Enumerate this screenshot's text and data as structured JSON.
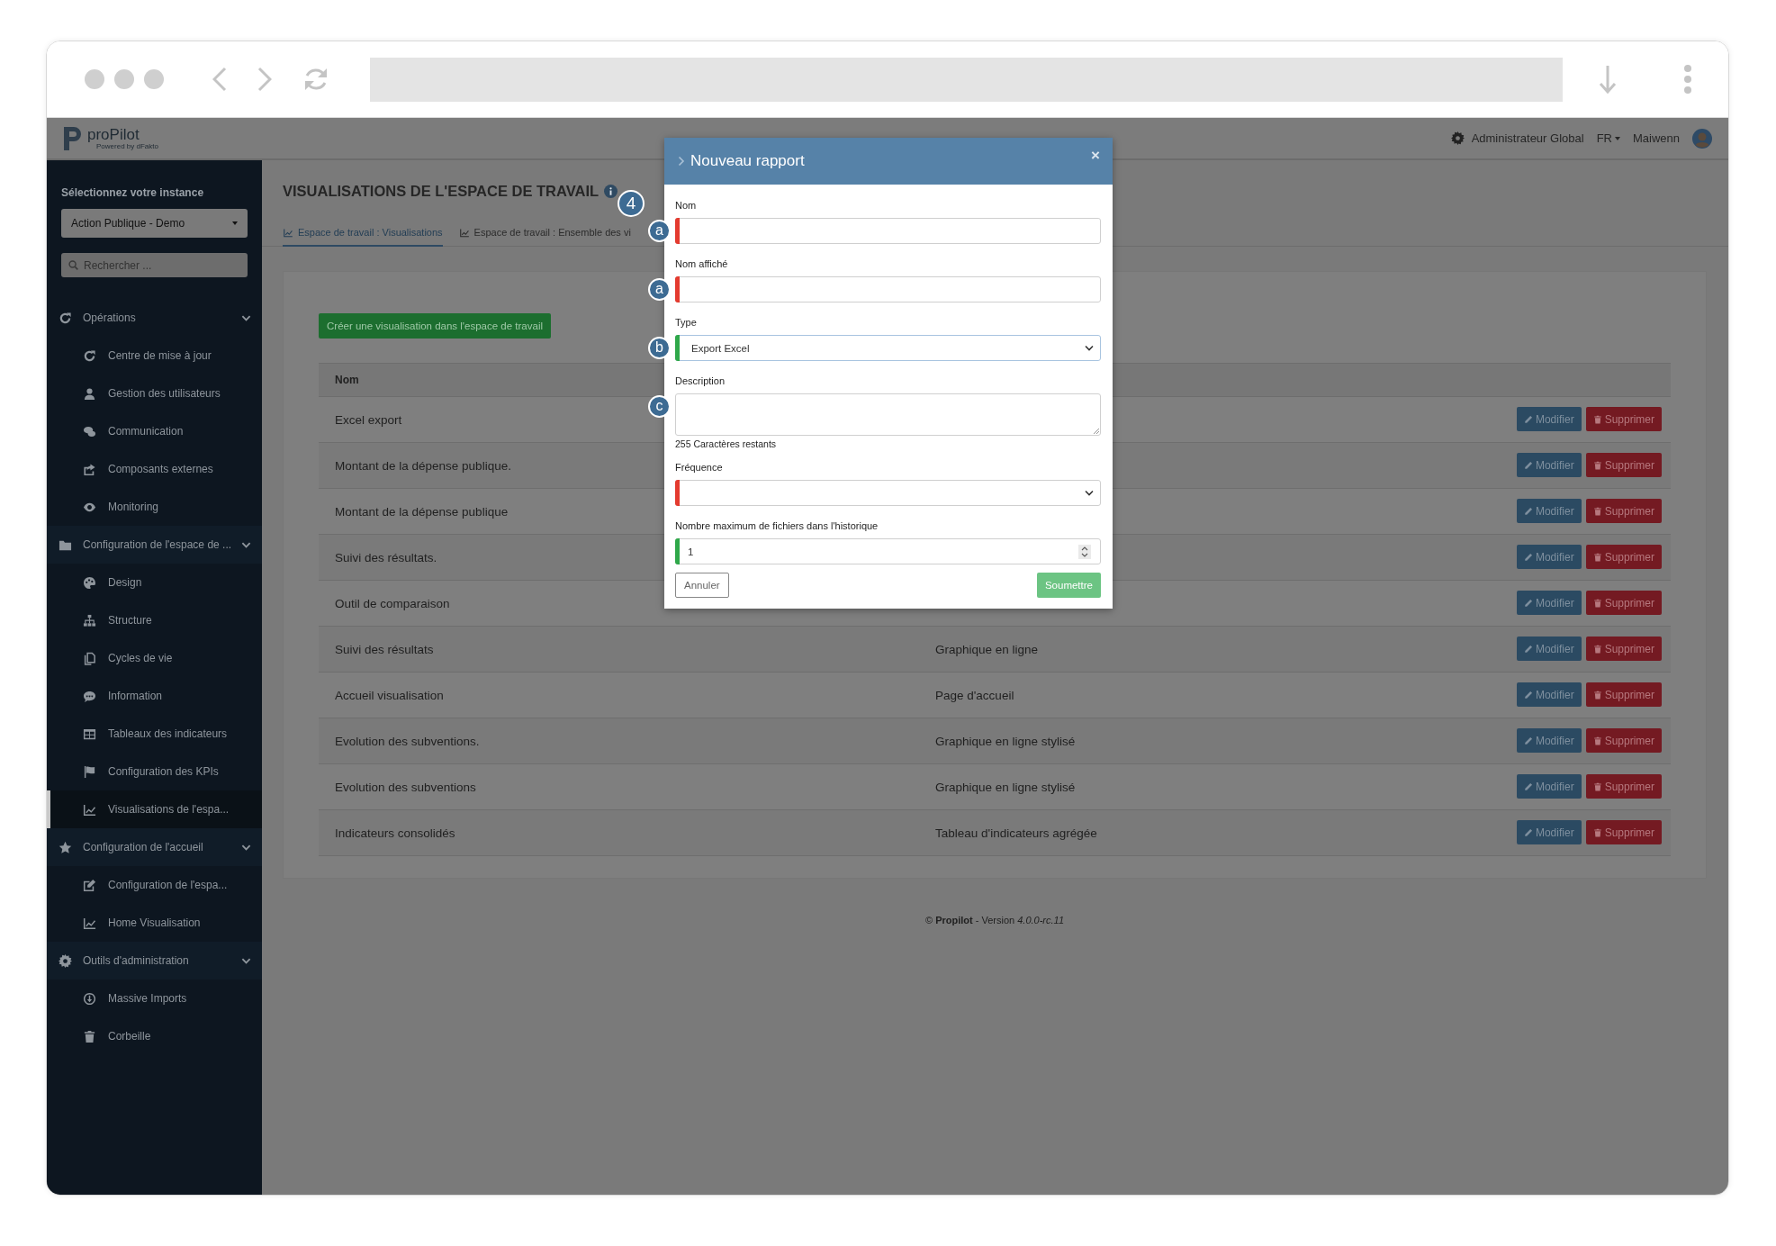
{
  "header": {
    "logo": "proPilot",
    "logo_tagline": "Powered by dFakto",
    "role": "Administrateur Global",
    "language": "FR",
    "user": "Maiwenn"
  },
  "sidebar": {
    "instance_label": "Sélectionnez votre instance",
    "instance": "Action Publique - Demo",
    "search": {
      "placeholder": "Rechercher ..."
    },
    "sections": [
      {
        "label": "Opérations",
        "expanded": true,
        "items": [
          {
            "label": "Centre de mise à jour",
            "selected": false
          },
          {
            "label": "Gestion des utilisateurs",
            "selected": false
          },
          {
            "label": "Communication",
            "selected": false
          },
          {
            "label": "Composants externes",
            "selected": false
          },
          {
            "label": "Monitoring",
            "selected": false
          }
        ]
      },
      {
        "label": "Configuration de l'espace de ...",
        "expanded": true,
        "items": [
          {
            "label": "Design",
            "selected": false
          },
          {
            "label": "Structure",
            "selected": false
          },
          {
            "label": "Cycles de vie",
            "selected": false
          },
          {
            "label": "Information",
            "selected": false
          },
          {
            "label": "Tableaux des indicateurs",
            "selected": false
          },
          {
            "label": "Configuration des KPIs",
            "selected": false
          },
          {
            "label": "Visualisations de l'espa...",
            "selected": true
          }
        ]
      },
      {
        "label": "Configuration de l'accueil",
        "expanded": true,
        "items": [
          {
            "label": "Configuration de l'espa...",
            "selected": false
          },
          {
            "label": "Home Visualisation",
            "selected": false
          }
        ]
      },
      {
        "label": "Outils d'administration",
        "expanded": true,
        "items": [
          {
            "label": "Massive Imports",
            "selected": false
          },
          {
            "label": "Corbeille",
            "selected": false
          }
        ]
      }
    ]
  },
  "main": {
    "title": "VISUALISATIONS DE L'ESPACE DE TRAVAIL",
    "tabs": [
      {
        "label": "Espace de travail : Visualisations",
        "selected": true
      },
      {
        "label": "Espace de travail : Ensemble des vi",
        "selected": false
      }
    ],
    "create_button": "Créer une visualisation dans l'espace de travail",
    "table": {
      "columns": [
        "Nom"
      ],
      "rows": [
        {
          "name": "Excel export",
          "edit_button": "Modifier",
          "delete_button": "Supprimer"
        },
        {
          "name": "Montant de la dépense publique.",
          "edit_button": "Modifier",
          "delete_button": "Supprimer"
        },
        {
          "name": "Montant de la dépense publique",
          "edit_button": "Modifier",
          "delete_button": "Supprimer"
        },
        {
          "name": "Suivi des résultats.",
          "edit_button": "Modifier",
          "delete_button": "Supprimer"
        },
        {
          "name": "Outil de comparaison",
          "edit_button": "Modifier",
          "delete_button": "Supprimer"
        },
        {
          "name": "Suivi des résultats",
          "type": "Graphique en ligne",
          "edit_button": "Modifier",
          "delete_button": "Supprimer"
        },
        {
          "name": "Accueil visualisation",
          "type": "Page d'accueil",
          "edit_button": "Modifier",
          "delete_button": "Supprimer"
        },
        {
          "name": "Evolution des subventions.",
          "type": "Graphique en ligne stylisé",
          "edit_button": "Modifier",
          "delete_button": "Supprimer"
        },
        {
          "name": "Evolution des subventions",
          "type": "Graphique en ligne stylisé",
          "edit_button": "Modifier",
          "delete_button": "Supprimer"
        },
        {
          "name": "Indicateurs consolidés",
          "type": "Tableau d'indicateurs agrégée",
          "edit_button": "Modifier",
          "delete_button": "Supprimer"
        }
      ]
    }
  },
  "footer": "© **Propilot** - Version *4.0.0-rc.11*",
  "modal": {
    "title": "Nouveau rapport",
    "close": "×",
    "step_marker": "4",
    "fields": [
      {
        "label": "Nom",
        "kind": "text",
        "valid": false,
        "marker": "a"
      },
      {
        "label": "Nom affiché",
        "kind": "text",
        "valid": false,
        "marker": "a"
      },
      {
        "label": "Type",
        "kind": "select",
        "value": "Export Excel",
        "valid": true,
        "marker": "b"
      },
      {
        "label": "Description",
        "kind": "textarea",
        "marker": "c",
        "hint": "255 Caractères restants"
      },
      {
        "label": "Fréquence",
        "kind": "select",
        "valid": false
      },
      {
        "label": "Nombre maximum de fichiers dans l'historique",
        "kind": "number",
        "value": "1",
        "valid": true
      }
    ],
    "cancel_button": "Annuler",
    "submit_button": "Soumettre"
  }
}
